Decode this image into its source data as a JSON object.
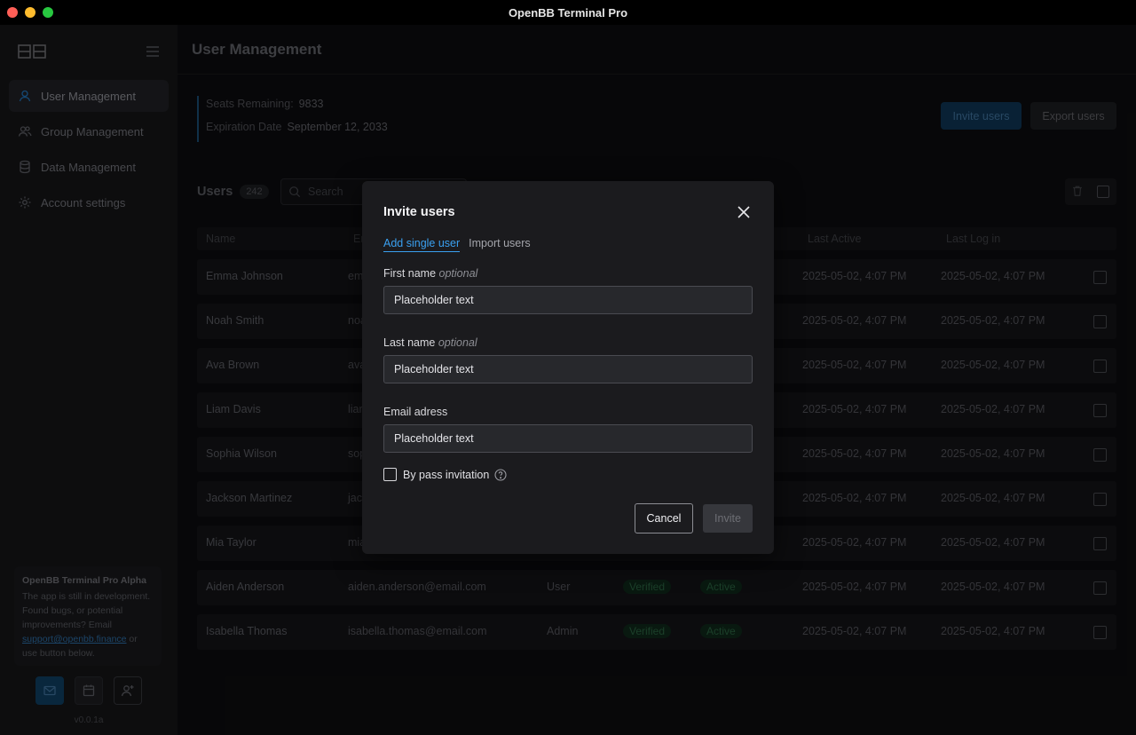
{
  "window": {
    "title": "OpenBB Terminal Pro"
  },
  "sidebar": {
    "items": [
      {
        "label": "User Management",
        "icon": "user-icon",
        "active": true
      },
      {
        "label": "Group Management",
        "icon": "users-icon",
        "active": false
      },
      {
        "label": "Data Management",
        "icon": "database-icon",
        "active": false
      },
      {
        "label": "Account settings",
        "icon": "gear-icon",
        "active": false
      }
    ],
    "promo": {
      "title": "OpenBB Terminal Pro Alpha",
      "text_before": "The app is still in development. Found bugs, or potential improvements? Email ",
      "link": "support@openbb.finance",
      "text_after": " or use button below."
    },
    "version": "v0.0.1a"
  },
  "main": {
    "page_title": "User Management",
    "seats_label": "Seats Remaining:",
    "seats_value": "9833",
    "expiration_label": "Expiration Date",
    "expiration_value": "September 12, 2033",
    "invite_button": "Invite users",
    "export_button": "Export users",
    "users_label": "Users",
    "users_count": "242",
    "search_placeholder": "Search",
    "columns": {
      "name": "Name",
      "email": "Em",
      "last_active": "Last Active",
      "last_login": "Last Log in"
    },
    "rows": [
      {
        "name": "Emma Johnson",
        "email": "em",
        "role": "",
        "verified": "",
        "status": "",
        "last_active": "2025-05-02, 4:07 PM",
        "last_login": "2025-05-02, 4:07 PM"
      },
      {
        "name": "Noah Smith",
        "email": "noa",
        "role": "",
        "verified": "",
        "status": "",
        "last_active": "2025-05-02, 4:07 PM",
        "last_login": "2025-05-02, 4:07 PM"
      },
      {
        "name": "Ava Brown",
        "email": "ava",
        "role": "",
        "verified": "",
        "status": "",
        "last_active": "2025-05-02, 4:07 PM",
        "last_login": "2025-05-02, 4:07 PM"
      },
      {
        "name": "Liam Davis",
        "email": "liar",
        "role": "",
        "verified": "",
        "status": "",
        "last_active": "2025-05-02, 4:07 PM",
        "last_login": "2025-05-02, 4:07 PM"
      },
      {
        "name": "Sophia Wilson",
        "email": "sop",
        "role": "",
        "verified": "",
        "status": "",
        "last_active": "2025-05-02, 4:07 PM",
        "last_login": "2025-05-02, 4:07 PM"
      },
      {
        "name": "Jackson Martinez",
        "email": "jac",
        "role": "",
        "verified": "",
        "status": "",
        "last_active": "2025-05-02, 4:07 PM",
        "last_login": "2025-05-02, 4:07 PM"
      },
      {
        "name": "Mia Taylor",
        "email": "mia",
        "role": "",
        "verified": "",
        "status": "",
        "last_active": "2025-05-02, 4:07 PM",
        "last_login": "2025-05-02, 4:07 PM"
      },
      {
        "name": "Aiden Anderson",
        "email": "aiden.anderson@email.com",
        "role": "User",
        "verified": "Verified",
        "status": "Active",
        "last_active": "2025-05-02, 4:07 PM",
        "last_login": "2025-05-02, 4:07 PM"
      },
      {
        "name": "Isabella Thomas",
        "email": "isabella.thomas@email.com",
        "role": "Admin",
        "verified": "Verified",
        "status": "Active",
        "last_active": "2025-05-02, 4:07 PM",
        "last_login": "2025-05-02, 4:07 PM"
      }
    ]
  },
  "modal": {
    "title": "Invite users",
    "tabs": [
      "Add single user",
      "Import users"
    ],
    "first_name_label": "First name",
    "last_name_label": "Last name",
    "optional": "optional",
    "email_label": "Email adress",
    "placeholder": "Placeholder text",
    "bypass_label": "By pass invitation",
    "cancel": "Cancel",
    "submit": "Invite"
  },
  "colors": {
    "accent": "#3aa0f0",
    "primary_dark": "#0e3452",
    "success": "#2a6140"
  }
}
